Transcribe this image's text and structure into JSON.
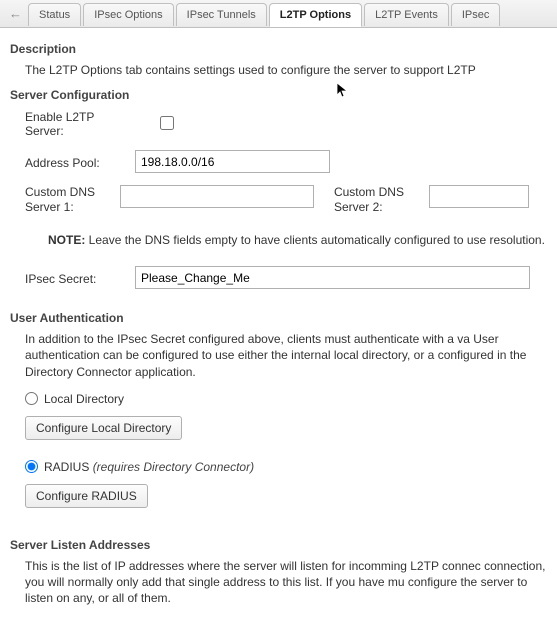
{
  "tabs": {
    "status": "Status",
    "ipsec_options": "IPsec Options",
    "ipsec_tunnels": "IPsec Tunnels",
    "l2tp_options": "L2TP Options",
    "l2tp_events": "L2TP Events",
    "ipsec": "IPsec"
  },
  "description": {
    "title": "Description",
    "text": "The L2TP Options tab contains settings used to configure the server to support L2TP"
  },
  "server_config": {
    "title": "Server Configuration",
    "enable_label": "Enable L2TP Server:",
    "address_pool_label": "Address Pool:",
    "address_pool_value": "198.18.0.0/16",
    "dns1_label": "Custom DNS Server 1:",
    "dns1_value": "",
    "dns2_label": "Custom DNS Server 2:",
    "dns2_value": "",
    "note_bold": "NOTE:",
    "note_text": " Leave the DNS fields empty to have clients automatically configured to use resolution.",
    "ipsec_secret_label": "IPsec Secret:",
    "ipsec_secret_value": "Please_Change_Me"
  },
  "user_auth": {
    "title": "User Authentication",
    "text": "In addition to the IPsec Secret configured above, clients must authenticate with a va User authentication can be configured to use either the internal local directory, or a configured in the Directory Connector application.",
    "local_label": "Local Directory",
    "configure_local_label": "Configure Local Directory",
    "radius_label": "RADIUS ",
    "radius_italic": "(requires Directory Connector)",
    "configure_radius_label": "Configure RADIUS"
  },
  "listen": {
    "title": "Server Listen Addresses",
    "text": "This is the list of IP addresses where the server will listen for incomming L2TP connec connection, you will normally only add that single address to this list. If you have mu configure the server to listen on any, or all of them."
  }
}
